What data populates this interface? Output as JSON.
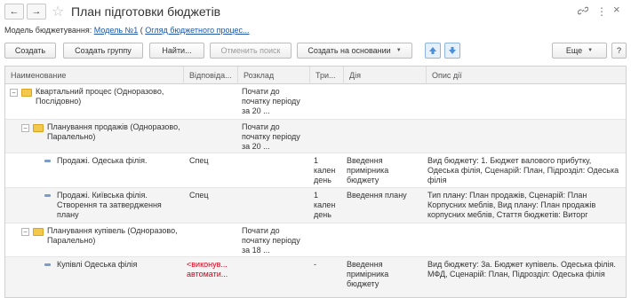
{
  "window": {
    "title": "План підготовки бюджетів",
    "back_icon": "←",
    "forward_icon": "→",
    "star_icon": "☆",
    "link_icon": "🔗",
    "more_icon": "⋮",
    "close_icon": "×"
  },
  "model_line": {
    "label": "Модель бюджетування:",
    "model_link": "Модель №1",
    "paren_open": "(",
    "overview_link": "Огляд бюджетного процес..."
  },
  "toolbar": {
    "create": "Создать",
    "create_group": "Создать группу",
    "find": "Найти...",
    "cancel_search": "Отменить поиск",
    "create_based_on": "Создать на основании",
    "more": "Еще",
    "help": "?"
  },
  "table": {
    "columns": [
      "Наименование",
      "Відповіда...",
      "Розклад",
      "Три...",
      "Дія",
      "Опис дії"
    ],
    "rows": [
      {
        "name": "Квартальний процес (Одноразово,\nПослідовно)",
        "resp": "",
        "schedule": "Почати до\nпочатку періоду\nза 20 ...",
        "duration": "",
        "action": "",
        "description": ""
      },
      {
        "name": "Планування продажів (Одноразово,\nПаралельно)",
        "resp": "",
        "schedule": "Почати до\nпочатку періоду\nза 20 ...",
        "duration": "",
        "action": "",
        "description": ""
      },
      {
        "name": "Продажі. Одеська філія.",
        "resp": "Спец",
        "schedule": "",
        "duration": "1\nкален\nдень",
        "action": "Введення\nпримірника\nбюджету",
        "description": "Вид бюджету: 1. Бюджет валового прибутку,\nОдеська філія, Сценарій: План, Підрозділ: Одеська\nфілія"
      },
      {
        "name": "Продажі. Київська філія.\nСтворення та затвердження\nплану",
        "resp": "Спец",
        "schedule": "",
        "duration": "1\nкален\nдень",
        "action": "Введення плану",
        "description": "Тип плану: План продажів, Сценарій: План\nКорпусних меблів, Вид плану: План продажів\nкорпусних меблів, Стаття бюджетів: Виторг"
      },
      {
        "name": "Планування купівель (Одноразово,\nПаралельно)",
        "resp": "",
        "schedule": "Почати до\nпочатку періоду\nза 18 ...",
        "duration": "",
        "action": "",
        "description": ""
      },
      {
        "name": "Купівлі Одеська філія",
        "resp": "<виконув...\nавтомати...",
        "schedule": "",
        "duration": "-",
        "action": "Введення\nпримірника\nбюджету",
        "description": "Вид бюджету: 3а. Бюджет купівель. Одеська філія.\nМФД, Сценарій: План, Підрозділ: Одеська філія"
      }
    ]
  },
  "colors": {
    "link": "#1b57a6",
    "folder": "#f2c94c",
    "red_text": "#d0021b",
    "arrow_button": "#4a90d9"
  }
}
